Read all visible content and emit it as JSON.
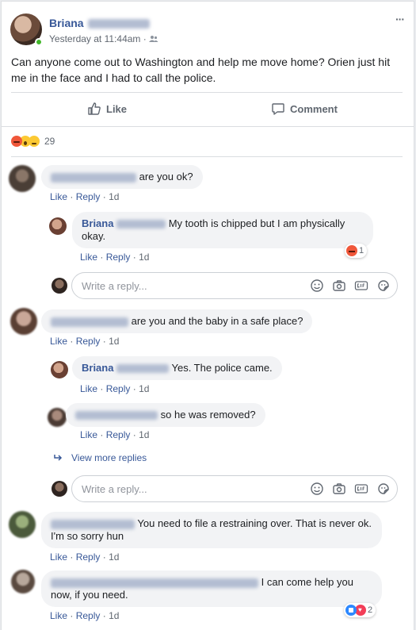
{
  "post": {
    "author_first": "Briana",
    "time": "Yesterday at 11:44am",
    "privacy_sep": "·",
    "more": "···",
    "text": "Can anyone come out to Washington and help me move home? Orien just hit me in the face and I had to call the police.",
    "like_label": "Like",
    "comment_label": "Comment",
    "reaction_count": "29"
  },
  "actions": {
    "like": "Like",
    "reply": "Reply",
    "sep": "·"
  },
  "reply_placeholder": "Write a reply...",
  "comments": [
    {
      "text": "are you ok?",
      "time": "1d"
    },
    {
      "author_first": "Briana",
      "text": "My tooth is chipped but I am physically okay.",
      "time": "1d",
      "reactions": "1"
    },
    {
      "text": "are you and the baby in a safe place?",
      "time": "1d"
    },
    {
      "author_first": "Briana",
      "text": "Yes. The police came.",
      "time": "1d"
    },
    {
      "text": "so he was removed?",
      "time": "1d"
    },
    {
      "text": "You need to file a restraining over. That is never ok. I'm so sorry hun",
      "time": "1d"
    },
    {
      "text": "I can come help you now, if you need.",
      "time": "1d",
      "reactions": "2"
    }
  ],
  "view_more": "View more replies",
  "colors": {
    "link": "#385898",
    "meta": "#606770",
    "bubble": "#f2f3f5",
    "online": "#42b72a",
    "angry": "#f0573a",
    "like_blue": "#2d88ff",
    "love_red": "#f33e58"
  }
}
